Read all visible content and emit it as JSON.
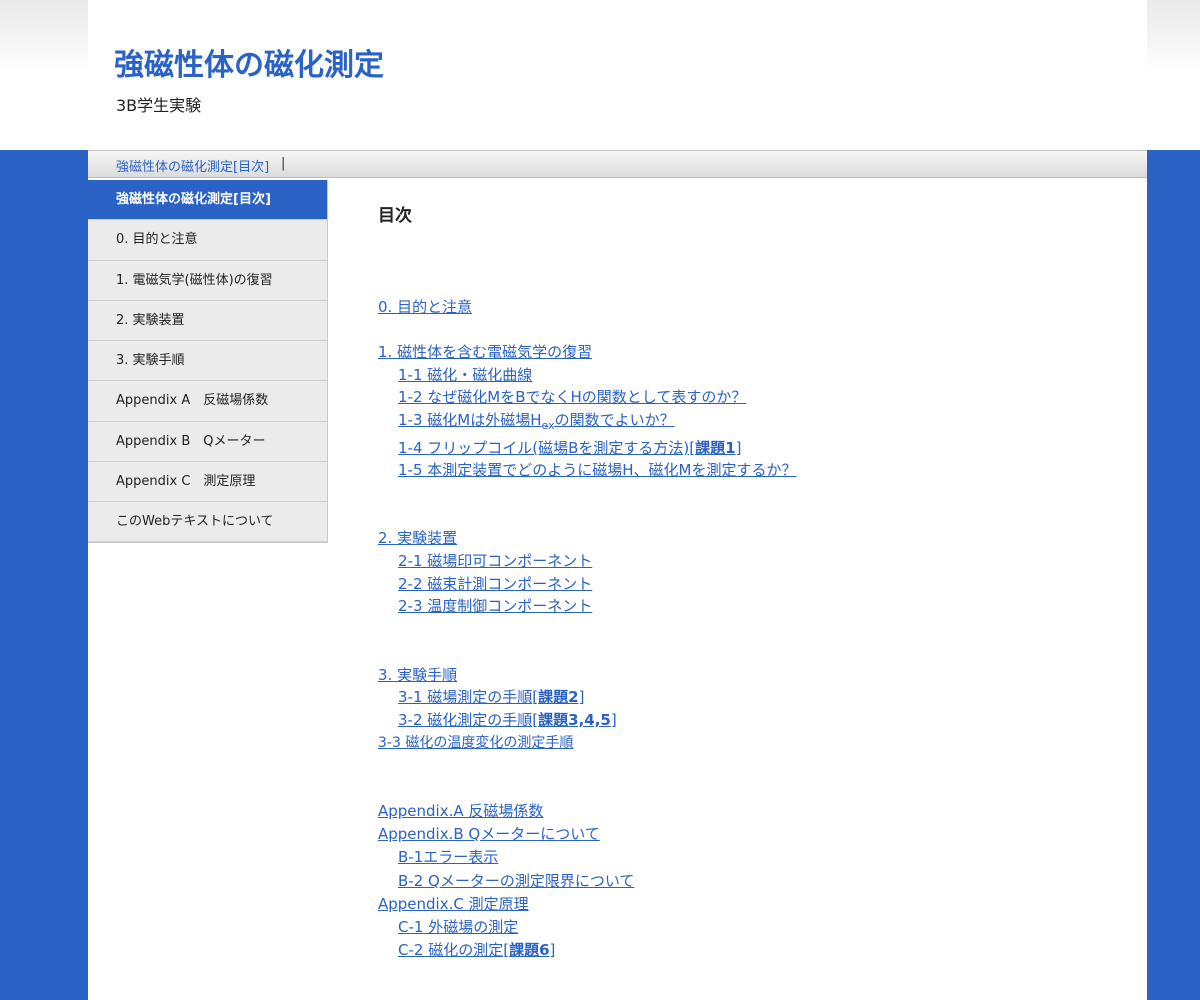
{
  "header": {
    "title": "強磁性体の磁化測定",
    "subtitle": "3B学生実験"
  },
  "breadcrumb": {
    "link": "強磁性体の磁化測定[目次]",
    "separator": "|"
  },
  "sidebar": {
    "items": [
      {
        "label": "強磁性体の磁化測定[目次]",
        "active": true
      },
      {
        "label": "0. 目的と注意"
      },
      {
        "label": "1. 電磁気学(磁性体)の復習"
      },
      {
        "label": "2. 実験装置"
      },
      {
        "label": "3. 実験手順"
      },
      {
        "label": "Appendix A　反磁場係数"
      },
      {
        "label": "Appendix B　Qメーター"
      },
      {
        "label": "Appendix C　測定原理"
      },
      {
        "label": "このWebテキストについて"
      }
    ]
  },
  "content": {
    "heading": "目次",
    "toc": {
      "s0": "0. 目的と注意",
      "s1": "1. 磁性体を含む電磁気学の復習",
      "s1_1": "1-1 磁化・磁化曲線",
      "s1_2": "1-2 なぜ磁化MをBでなくHの関数として表すのか？",
      "s1_3_pre": "1-3 磁化Mは外磁場H",
      "s1_3_sub": "ex",
      "s1_3_post": "の関数でよいか？",
      "s1_4": "1-4 フリップコイル(磁場Bを測定する方法)",
      "s1_4_task": "課題1",
      "s1_5": "1-5 本測定装置でどのように磁場H、磁化Mを測定するか？",
      "s2": "2. 実験装置",
      "s2_1": "2-1 磁場印可コンポーネント",
      "s2_2": "2-2 磁束計測コンポーネント",
      "s2_3": "2-3 温度制御コンポーネント",
      "s3": "3. 実験手順",
      "s3_1": "3-1 磁場測定の手順",
      "s3_1_task": "課題2",
      "s3_2": "3-2 磁化測定の手順",
      "s3_2_task": "課題3,4,5",
      "s3_3": "3-3 磁化の温度変化の測定手順",
      "a": "Appendix.A 反磁場係数",
      "b": "Appendix.B Qメーターについて",
      "b1": "B-1エラー表示",
      "b2": "B-2 Qメーターの測定限界について",
      "c": "Appendix.C 測定原理",
      "c1": "C-1 外磁場の測定",
      "c2": "C-2 磁化の測定",
      "c2_task": "課題6"
    },
    "brackets": {
      "open": "[",
      "close": "]"
    }
  },
  "colors": {
    "accent": "#2a62c6",
    "sidebar_bg": "#ebebeb"
  }
}
